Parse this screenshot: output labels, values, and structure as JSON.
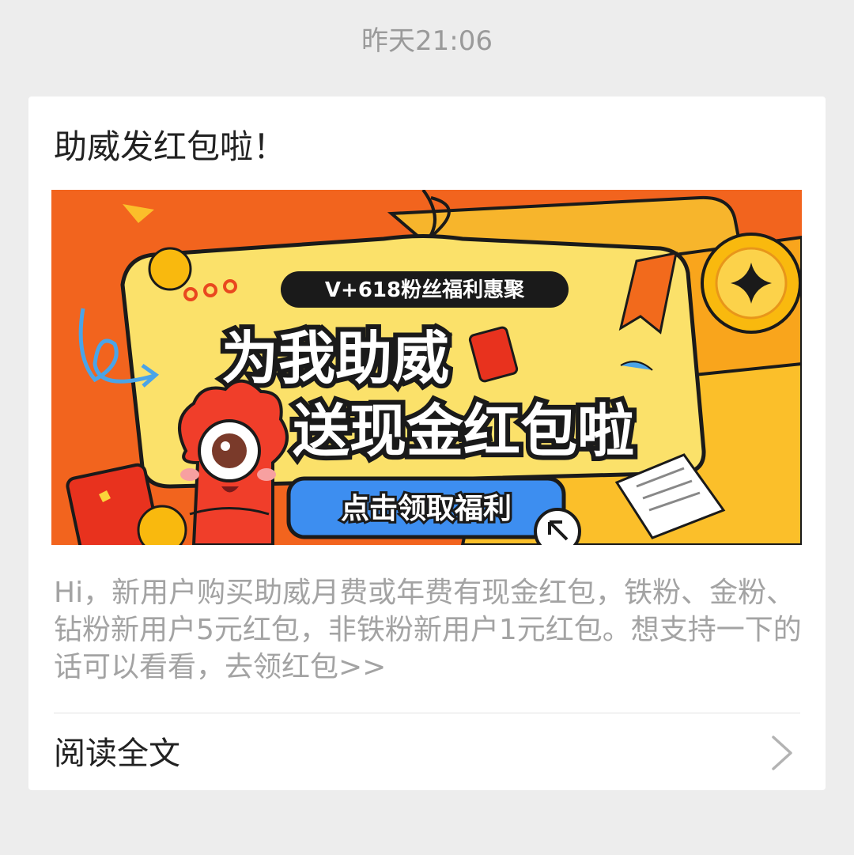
{
  "timestamp": "昨天21:06",
  "article": {
    "title": "助威发红包啦！",
    "banner": {
      "tag": "V+618粉丝福利惠聚",
      "headline_line1": "为我助威",
      "headline_line2": "送现金红包啦",
      "cta": "点击领取福利",
      "colors": {
        "background": "#f2641e",
        "panel": "#fbe16a",
        "tag_bg": "#1a1a1a",
        "cta_bg": "#3d8ef0",
        "mascot": "#f03e2a",
        "coin": "#f9b90e"
      }
    },
    "description": "Hi，新用户购买助威月费或年费有现金红包，铁粉、金粉、钻粉新用户5元红包，非铁粉新用户1元红包。想支持一下的话可以看看，去领红包>>",
    "read_more": "阅读全文"
  },
  "icons": {
    "read_more": "chevron-right-icon"
  }
}
